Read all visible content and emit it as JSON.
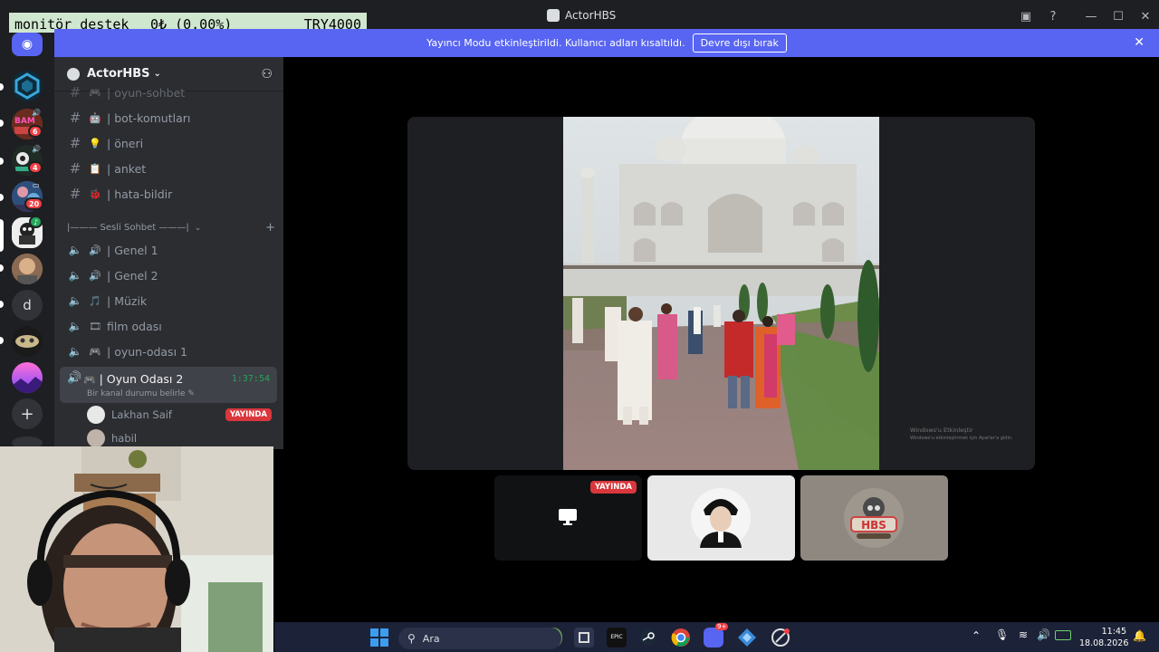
{
  "window": {
    "title": "ActorHBS"
  },
  "overlay": {
    "label": "monitör destek",
    "balance": "0₺ (0.00%)",
    "goal": "TRY4000"
  },
  "notice": {
    "text": "Yayıncı Modu etkinleştirildi. Kullanıcı adları kısaltıldı.",
    "button": "Devre dışı bırak"
  },
  "rail": {
    "badges": [
      "6",
      "4",
      "20"
    ],
    "dm_letter": "d",
    "add": "+"
  },
  "sidebar": {
    "guild_name": "ActorHBS",
    "text_channels": [
      {
        "name": "oyun-sohbet",
        "emoji": "🎮",
        "prefix": "#"
      },
      {
        "name": "bot-komutları",
        "emoji": "🤖",
        "prefix": "#"
      },
      {
        "name": "öneri",
        "emoji": "💡",
        "prefix": "#"
      },
      {
        "name": "anket",
        "emoji": "📋",
        "prefix": "#"
      },
      {
        "name": "hata-bildir",
        "emoji": "🐞",
        "prefix": "#"
      }
    ],
    "category": "|——— Sesli Sohbet ———|",
    "voice_channels": [
      {
        "name": "Genel 1",
        "emoji": "🔊"
      },
      {
        "name": "Genel 2",
        "emoji": "🔊"
      },
      {
        "name": "Müzik",
        "emoji": "🎵"
      },
      {
        "name": "film odası",
        "emoji": "🎞"
      },
      {
        "name": "oyun-odası 1",
        "emoji": "🎮"
      }
    ],
    "active_channel": {
      "name": "Oyun Odası 2",
      "emoji": "🎮",
      "timer": "1:37:54",
      "status": "Bir kanal durumu belirle"
    },
    "members": [
      {
        "name": "Lakhan Saif",
        "live": "YAYINDA"
      },
      {
        "name": "habil",
        "live": ""
      }
    ]
  },
  "stage": {
    "watermark_title": "Windows'u Etkinleştir",
    "watermark_sub": "Windows'u etkinleştirmek için Ayarlar'a gidin.",
    "thumb_live": "YAYINDA"
  },
  "taskbar": {
    "search_placeholder": "Ara",
    "time": "11:45",
    "date": "18.08.2026",
    "discord_badge": "9+"
  },
  "colors": {
    "blurple": "#5865f2",
    "live_red": "#da373c",
    "speaking_green": "#23a55a"
  }
}
